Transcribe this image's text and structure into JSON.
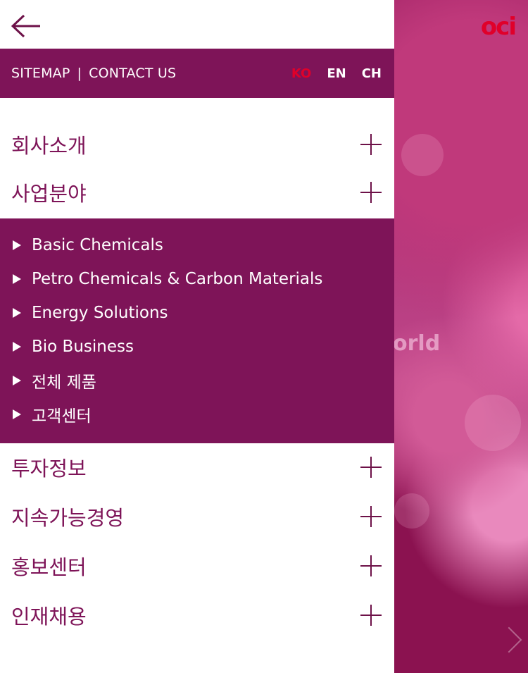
{
  "hero": {
    "logo": "oci",
    "overlay_text": "orld"
  },
  "header": {
    "back_icon": "arrow-left-icon"
  },
  "utility": {
    "sitemap": "SITEMAP",
    "separator": "|",
    "contact": "CONTACT US",
    "languages": [
      {
        "label": "KO",
        "color": "#e0002a"
      },
      {
        "label": "EN",
        "color": "#ffffff"
      },
      {
        "label": "CH",
        "color": "#ffffff"
      }
    ]
  },
  "menu": [
    {
      "label": "회사소개"
    },
    {
      "label": "사업분야"
    },
    {
      "label": "투자정보"
    },
    {
      "label": "지속가능경영"
    },
    {
      "label": "홍보센터"
    },
    {
      "label": "인재채용"
    }
  ],
  "submenu": [
    {
      "label": "Basic Chemicals"
    },
    {
      "label": "Petro Chemicals & Carbon Materials"
    },
    {
      "label": "Energy Solutions"
    },
    {
      "label": "Bio Business"
    },
    {
      "label": "전체 제품"
    },
    {
      "label": "고객센터"
    }
  ],
  "colors": {
    "brand": "#7e1458",
    "accent": "#e0002a"
  }
}
